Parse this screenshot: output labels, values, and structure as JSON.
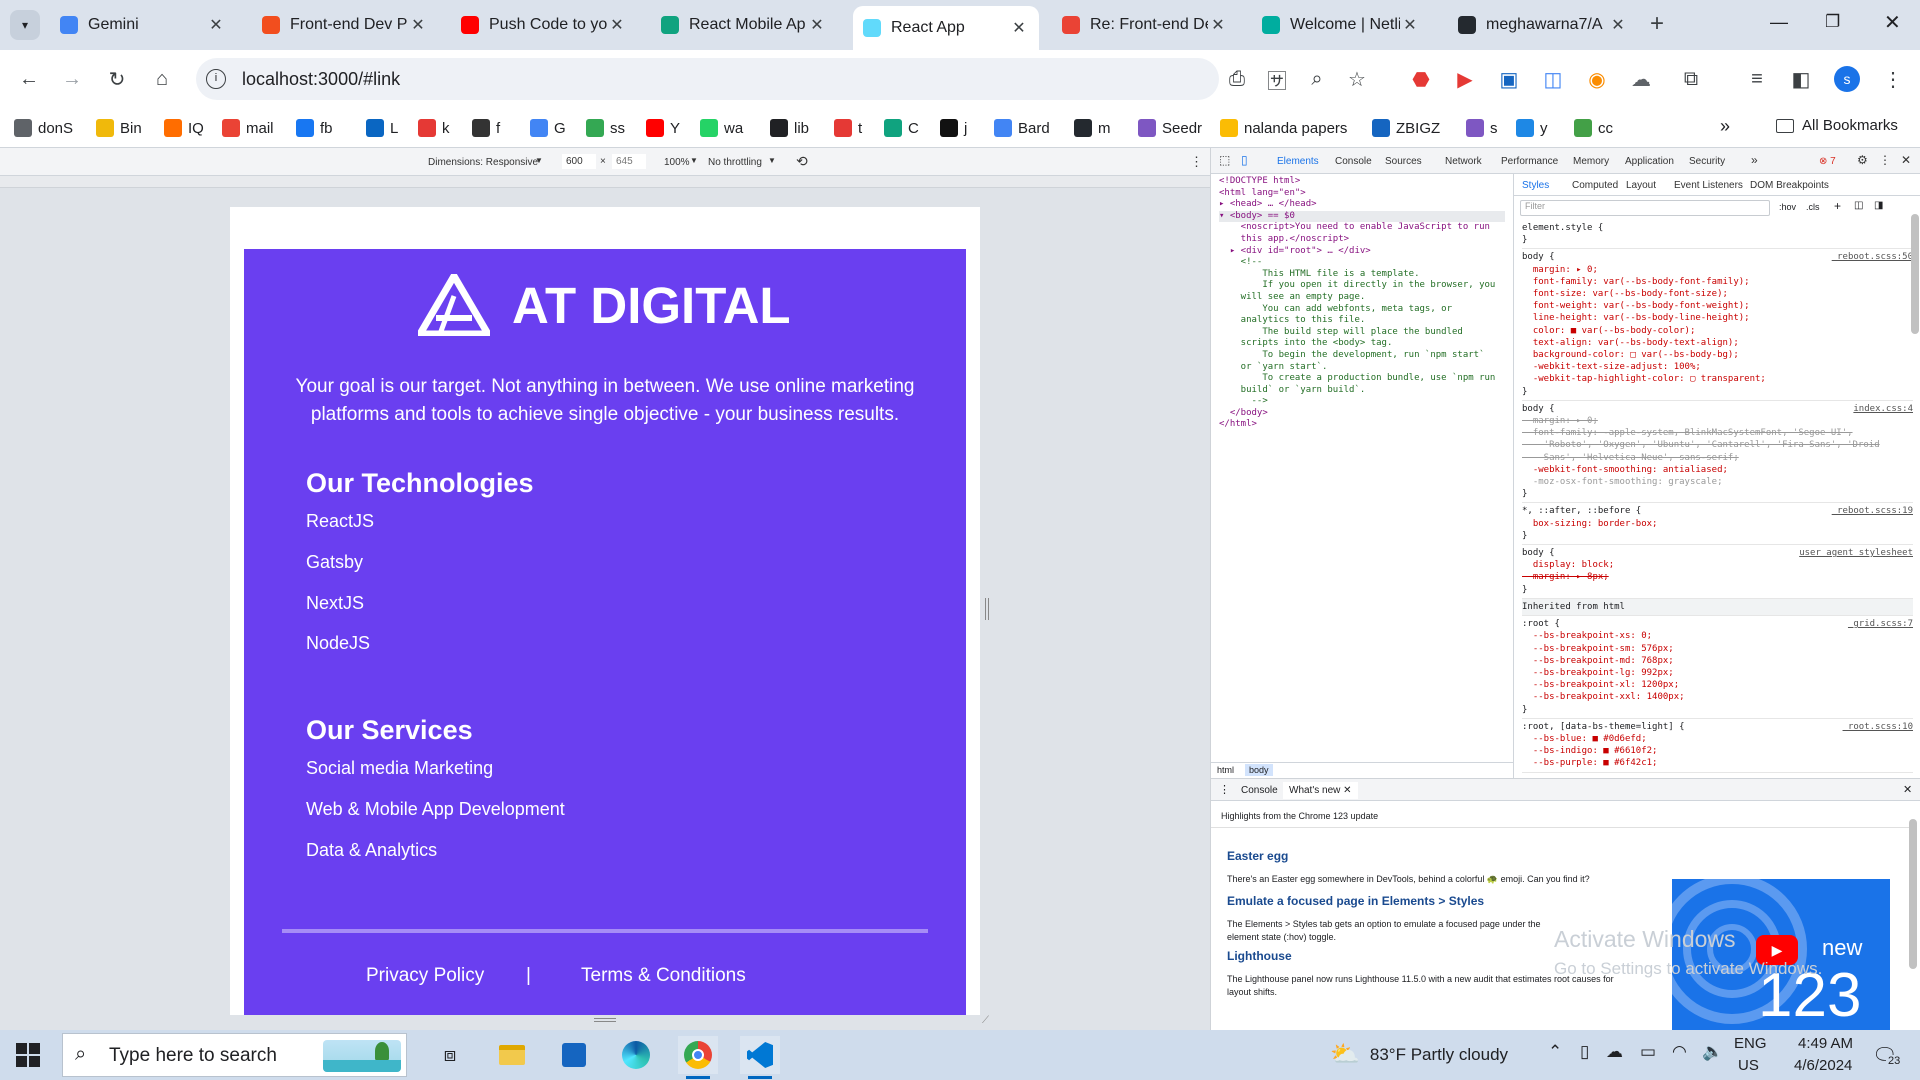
{
  "browser": {
    "tabs": [
      {
        "title": "Gemini",
        "icon": "gemini-icon",
        "color": "#4285f4"
      },
      {
        "title": "Front-end Dev P",
        "icon": "figma-icon",
        "color": "#f24e1e"
      },
      {
        "title": "Push Code to yo",
        "icon": "youtube-icon",
        "color": "#ff0000"
      },
      {
        "title": "React Mobile Ap",
        "icon": "chatgpt-icon",
        "color": "#10a37f"
      },
      {
        "title": "React App",
        "icon": "react-icon",
        "color": "#61dafb"
      },
      {
        "title": "Re: Front-end De",
        "icon": "gmail-icon",
        "color": "#ea4335"
      },
      {
        "title": "Welcome | Netlif",
        "icon": "netlify-icon",
        "color": "#00ad9f"
      },
      {
        "title": "meghawarna7/A",
        "icon": "github-icon",
        "color": "#24292f"
      }
    ],
    "new_tab_label": "+",
    "url": "localhost:3000/#link",
    "bookmarks": [
      {
        "label": "donS",
        "icon": "folder-icon",
        "color": "#5f6368"
      },
      {
        "label": "Bin",
        "icon": "binance-icon",
        "color": "#f0b90b"
      },
      {
        "label": "IQ",
        "icon": "iq-icon",
        "color": "#ff6d00"
      },
      {
        "label": "mail",
        "icon": "gmail-icon",
        "color": "#ea4335"
      },
      {
        "label": "fb",
        "icon": "facebook-icon",
        "color": "#1877f2"
      },
      {
        "label": "L",
        "icon": "linkedin-icon",
        "color": "#0a66c2"
      },
      {
        "label": "k",
        "icon": "k-icon",
        "color": "#e53935"
      },
      {
        "label": "f",
        "icon": "f-icon",
        "color": "#333333"
      },
      {
        "label": "G",
        "icon": "translate-icon",
        "color": "#4285f4"
      },
      {
        "label": "ss",
        "icon": "download-icon",
        "color": "#34a853"
      },
      {
        "label": "Y",
        "icon": "youtube-icon",
        "color": "#ff0000"
      },
      {
        "label": "wa",
        "icon": "whatsapp-icon",
        "color": "#25d366"
      },
      {
        "label": "lib",
        "icon": "library-icon",
        "color": "#202124"
      },
      {
        "label": "t",
        "icon": "x-icon",
        "color": "#e53935"
      },
      {
        "label": "C",
        "icon": "chatgpt-icon",
        "color": "#10a37f"
      },
      {
        "label": "j",
        "icon": "jw-icon",
        "color": "#111111"
      },
      {
        "label": "Bard",
        "icon": "bard-icon",
        "color": "#4285f4"
      },
      {
        "label": "m",
        "icon": "github-icon",
        "color": "#24292f"
      },
      {
        "label": "Seedr",
        "icon": "seedr-icon",
        "color": "#7e57c2"
      },
      {
        "label": "nalanda papers",
        "icon": "nalanda-icon",
        "color": "#fbbc04"
      },
      {
        "label": "ZBIGZ",
        "icon": "cloud-icon",
        "color": "#1565c0"
      },
      {
        "label": "s",
        "icon": "s-icon",
        "color": "#7e57c2"
      },
      {
        "label": "y",
        "icon": "y-icon",
        "color": "#1e88e5"
      },
      {
        "label": "cc",
        "icon": "chart-icon",
        "color": "#43a047"
      }
    ],
    "all_bookmarks": "All Bookmarks",
    "profile_initial": "s"
  },
  "device_toolbar": {
    "dimensions": "Dimensions: Responsive",
    "width": "600",
    "times": "×",
    "height": "645",
    "zoom": "100%",
    "throttle": "No throttling"
  },
  "site": {
    "brand": "AT DIGITAL",
    "tagline": "Your goal is our target. Not anything in between. We use online marketing platforms and tools to achieve single objective - your business results.",
    "tech_heading": "Our Technologies",
    "technologies": [
      "ReactJS",
      "Gatsby",
      "NextJS",
      "NodeJS"
    ],
    "services_heading": "Our Services",
    "services": [
      "Social media Marketing",
      "Web & Mobile App Development",
      "Data & Analytics"
    ],
    "privacy": "Privacy Policy",
    "separator": "|",
    "terms": "Terms & Conditions",
    "bg_color": "#6a3ff0"
  },
  "devtools": {
    "tabs": [
      "Elements",
      "Console",
      "Sources",
      "Network",
      "Performance",
      "Memory",
      "Application",
      "Security"
    ],
    "error_count": "7",
    "styles_tabs": [
      "Styles",
      "Computed",
      "Layout",
      "Event Listeners",
      "DOM Breakpoints"
    ],
    "filter_placeholder": "Filter",
    "hov": ":hov",
    "cls": ".cls",
    "dom_lines": [
      "<!DOCTYPE html>",
      "<html lang=\"en\">",
      "▸ <head> … </head>",
      "▾ <body> == $0",
      "    <noscript>You need to enable JavaScript to run",
      "    this app.</noscript>",
      "  ▸ <div id=\"root\"> … </div>",
      "    <!--",
      "        This HTML file is a template.",
      "        If you open it directly in the browser, you",
      "    will see an empty page.",
      "",
      "        You can add webfonts, meta tags, or",
      "    analytics to this file.",
      "        The build step will place the bundled",
      "    scripts into the <body> tag.",
      "",
      "        To begin the development, run `npm start`",
      "    or `yarn start`.",
      "        To create a production bundle, use `npm run",
      "    build` or `yarn build`.",
      "      -->",
      "  </body>",
      "</html>"
    ],
    "breadcrumbs": [
      "html",
      "body"
    ],
    "style_rules": [
      {
        "selector": "element.style {",
        "source": "",
        "props": [
          "}"
        ]
      },
      {
        "selector": "body {",
        "source": "_reboot.scss:50",
        "props": [
          "  margin: ▸ 0;",
          "  font-family: var(--bs-body-font-family);",
          "  font-size: var(--bs-body-font-size);",
          "  font-weight: var(--bs-body-font-weight);",
          "  line-height: var(--bs-body-line-height);",
          "  color: ■ var(--bs-body-color);",
          "  text-align: var(--bs-body-text-align);",
          "  background-color: □ var(--bs-body-bg);",
          "  -webkit-text-size-adjust: 100%;",
          "  -webkit-tap-highlight-color: ▢ transparent;",
          "}"
        ]
      },
      {
        "selector": "body {",
        "source": "index.css:4",
        "props": [
          "  margin: ▸ 0;",
          "  font-family: -apple-system, BlinkMacSystemFont, 'Segoe UI',",
          "    'Roboto', 'Oxygen', 'Ubuntu', 'Cantarell', 'Fira Sans', 'Droid",
          "    Sans', 'Helvetica Neue', sans-serif;",
          "  -webkit-font-smoothing: antialiased;",
          "  -moz-osx-font-smoothing: grayscale;",
          "}"
        ]
      },
      {
        "selector": "*, ::after, ::before {",
        "source": "_reboot.scss:19",
        "props": [
          "  box-sizing: border-box;",
          "}"
        ]
      },
      {
        "selector": "body {",
        "source": "user agent stylesheet",
        "props": [
          "  display: block;",
          "  margin: ▸ 8px;",
          "}"
        ]
      },
      {
        "selector": "Inherited from html",
        "source": "",
        "props": []
      },
      {
        "selector": ":root {",
        "source": "_grid.scss:7",
        "props": [
          "  --bs-breakpoint-xs: 0;",
          "  --bs-breakpoint-sm: 576px;",
          "  --bs-breakpoint-md: 768px;",
          "  --bs-breakpoint-lg: 992px;",
          "  --bs-breakpoint-xl: 1200px;",
          "  --bs-breakpoint-xxl: 1400px;",
          "}"
        ]
      },
      {
        "selector": ":root, [data-bs-theme=light] {",
        "source": "_root.scss:10",
        "props": [
          "  --bs-blue: ■ #0d6efd;",
          "  --bs-indigo: ■ #6610f2;",
          "  --bs-purple: ■ #6f42c1;"
        ]
      }
    ],
    "drawer_tabs": [
      "Console",
      "What's new"
    ],
    "whats_new": {
      "highlight": "Highlights from the Chrome 123 update",
      "items": [
        {
          "title": "Easter egg",
          "text": "There's an Easter egg somewhere in DevTools, behind a colorful 🐢 emoji. Can you find it?"
        },
        {
          "title": "Emulate a focused page in Elements > Styles",
          "text": "The Elements > Styles tab gets an option to emulate a focused page under the element state (:hov) toggle."
        },
        {
          "title": "Lighthouse",
          "text": "The Lighthouse panel now runs Lighthouse 11.5.0 with a new audit that estimates root causes for layout shifts."
        }
      ],
      "video_new": "new",
      "video_num": "123"
    }
  },
  "activate": {
    "line1": "Activate Windows",
    "line2": "Go to Settings to activate Windows."
  },
  "taskbar": {
    "search_placeholder": "Type here to search",
    "weather": "83°F  Partly cloudy",
    "lang1": "ENG",
    "lang2": "US",
    "time": "4:49 AM",
    "date": "4/6/2024",
    "notifications": "23"
  }
}
